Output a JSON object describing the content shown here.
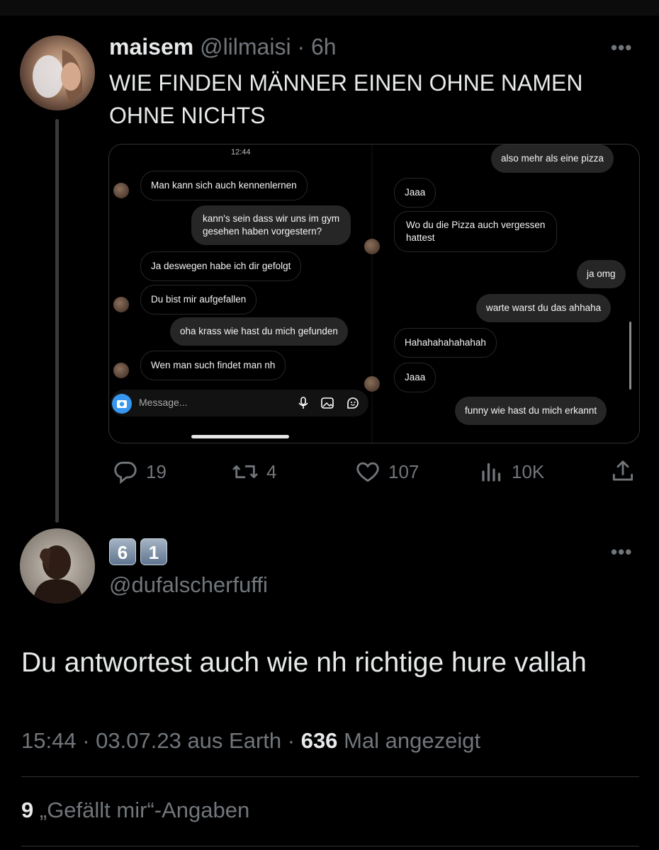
{
  "tweet": {
    "display_name": "maisem",
    "handle": "@lilmaisi",
    "time": "6h",
    "text_line1": "WIE FINDEN MÄNNER EINEN OHNE NAMEN",
    "text_line2": "OHNE NICHTS",
    "more": "•••",
    "media": {
      "left": {
        "status_time": "12:44",
        "messages": [
          {
            "side": "in",
            "text": "Man kann sich auch kennenlernen"
          },
          {
            "side": "out",
            "text": "kann's sein dass wir uns im gym"
          },
          {
            "side": "out",
            "text": "gesehen haben vorgestern?"
          },
          {
            "side": "in",
            "text": "Ja deswegen habe ich dir gefolgt"
          },
          {
            "side": "in",
            "text": "Du bist mir aufgefallen"
          },
          {
            "side": "out",
            "text": "oha krass wie hast du mich gefunden"
          },
          {
            "side": "in",
            "text": "Wen man such findet man nh"
          }
        ],
        "message_placeholder": "Message..."
      },
      "right": {
        "messages": [
          {
            "side": "out",
            "text": "also mehr als eine pizza"
          },
          {
            "side": "in",
            "text": "Jaaa"
          },
          {
            "side": "in",
            "text": "Wo du die Pizza auch vergessen"
          },
          {
            "side": "in",
            "text": "hattest"
          },
          {
            "side": "out",
            "text": "ja omg"
          },
          {
            "side": "out",
            "text": "warte warst du das ahhaha"
          },
          {
            "side": "in",
            "text": "Hahahahahahahah"
          },
          {
            "side": "in",
            "text": "Jaaa"
          },
          {
            "side": "out",
            "text": "funny wie hast du mich erkannt"
          }
        ]
      }
    },
    "stats": {
      "replies": "19",
      "retweets": "4",
      "likes": "107",
      "views": "10K"
    },
    "icons": [
      "reply-icon",
      "retweet-icon",
      "like-icon",
      "views-icon",
      "share-icon"
    ]
  },
  "reply": {
    "emoji_name": [
      "6",
      "1"
    ],
    "handle": "@dufalscherfuffi",
    "more": "•••",
    "text": "Du antwortest auch wie nh richtige hure vallah",
    "meta": {
      "time": "15:44",
      "date": "03.07.23",
      "source": "aus Earth",
      "views_count": "636",
      "views_label": "Mal angezeigt"
    },
    "likes_count": "9",
    "likes_label": "„Gefällt mir“-Angaben"
  },
  "colors": {
    "background": "#000000",
    "text": "#e7e9ea",
    "muted": "#71767b",
    "divider": "#2f3336",
    "camera_blue": "#3797f0"
  }
}
